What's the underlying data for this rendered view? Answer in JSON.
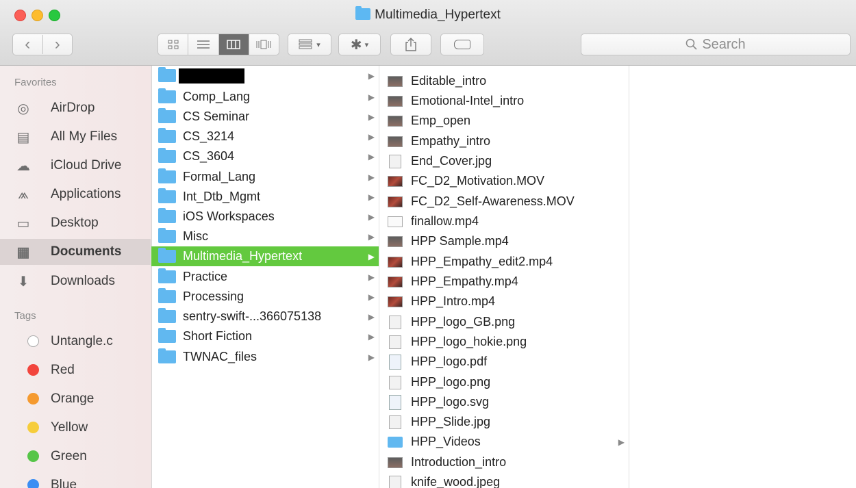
{
  "window": {
    "title": "Multimedia_Hypertext"
  },
  "toolbar": {
    "back_glyph": "‹",
    "forward_glyph": "›",
    "view_icons": [
      "icon-view-icon",
      "list-view-icon",
      "column-view-icon",
      "coverflow-view-icon"
    ],
    "search_placeholder": "Search"
  },
  "sidebar": {
    "favorites_header": "Favorites",
    "favorites": [
      {
        "label": "AirDrop",
        "icon": "airdrop-icon",
        "glyph": "◎"
      },
      {
        "label": "All My Files",
        "icon": "all-files-icon",
        "glyph": "▤"
      },
      {
        "label": "iCloud Drive",
        "icon": "cloud-icon",
        "glyph": "☁"
      },
      {
        "label": "Applications",
        "icon": "applications-icon",
        "glyph": "⩕"
      },
      {
        "label": "Desktop",
        "icon": "desktop-icon",
        "glyph": "▭"
      },
      {
        "label": "Documents",
        "icon": "documents-icon",
        "glyph": "▦"
      },
      {
        "label": "Downloads",
        "icon": "downloads-icon",
        "glyph": "⬇"
      }
    ],
    "tags_header": "Tags",
    "tags": [
      {
        "label": "Untangle.c",
        "color": "#ffffff"
      },
      {
        "label": "Red",
        "color": "#f2453d"
      },
      {
        "label": "Orange",
        "color": "#f59a2f"
      },
      {
        "label": "Yellow",
        "color": "#f6cd3b"
      },
      {
        "label": "Green",
        "color": "#56c548"
      },
      {
        "label": "Blue",
        "color": "#3c8ef3"
      }
    ]
  },
  "column1": {
    "items": [
      {
        "label": ""
      },
      {
        "label": "Comp_Lang"
      },
      {
        "label": "CS Seminar"
      },
      {
        "label": "CS_3214"
      },
      {
        "label": "CS_3604"
      },
      {
        "label": "Formal_Lang"
      },
      {
        "label": "Int_Dtb_Mgmt"
      },
      {
        "label": "iOS Workspaces"
      },
      {
        "label": "Misc"
      },
      {
        "label": "Multimedia_Hypertext",
        "selected": true
      },
      {
        "label": "Practice"
      },
      {
        "label": "Processing"
      },
      {
        "label": "sentry-swift-...366075138"
      },
      {
        "label": "Short Fiction"
      },
      {
        "label": "TWNAC_files"
      }
    ]
  },
  "column2": {
    "items": [
      {
        "label": "Editable_intro",
        "type": "video"
      },
      {
        "label": "Emotional-Intel_intro",
        "type": "video"
      },
      {
        "label": "Emp_open",
        "type": "video"
      },
      {
        "label": "Empathy_intro",
        "type": "video"
      },
      {
        "label": "End_Cover.jpg",
        "type": "image"
      },
      {
        "label": "FC_D2_Motivation.MOV",
        "type": "redvideo"
      },
      {
        "label": "FC_D2_Self-Awareness.MOV",
        "type": "redvideo"
      },
      {
        "label": "finallow.mp4",
        "type": "blank"
      },
      {
        "label": "HPP Sample.mp4",
        "type": "video"
      },
      {
        "label": "HPP_Empathy_edit2.mp4",
        "type": "redvideo"
      },
      {
        "label": "HPP_Empathy.mp4",
        "type": "redvideo"
      },
      {
        "label": "HPP_Intro.mp4",
        "type": "redvideo"
      },
      {
        "label": "HPP_logo_GB.png",
        "type": "image"
      },
      {
        "label": "HPP_logo_hokie.png",
        "type": "image"
      },
      {
        "label": "HPP_logo.pdf",
        "type": "doc"
      },
      {
        "label": "HPP_logo.png",
        "type": "image"
      },
      {
        "label": "HPP_logo.svg",
        "type": "doc"
      },
      {
        "label": "HPP_Slide.jpg",
        "type": "image"
      },
      {
        "label": "HPP_Videos",
        "type": "folder"
      },
      {
        "label": "Introduction_intro",
        "type": "video"
      },
      {
        "label": "knife_wood.jpeg",
        "type": "image"
      }
    ]
  }
}
